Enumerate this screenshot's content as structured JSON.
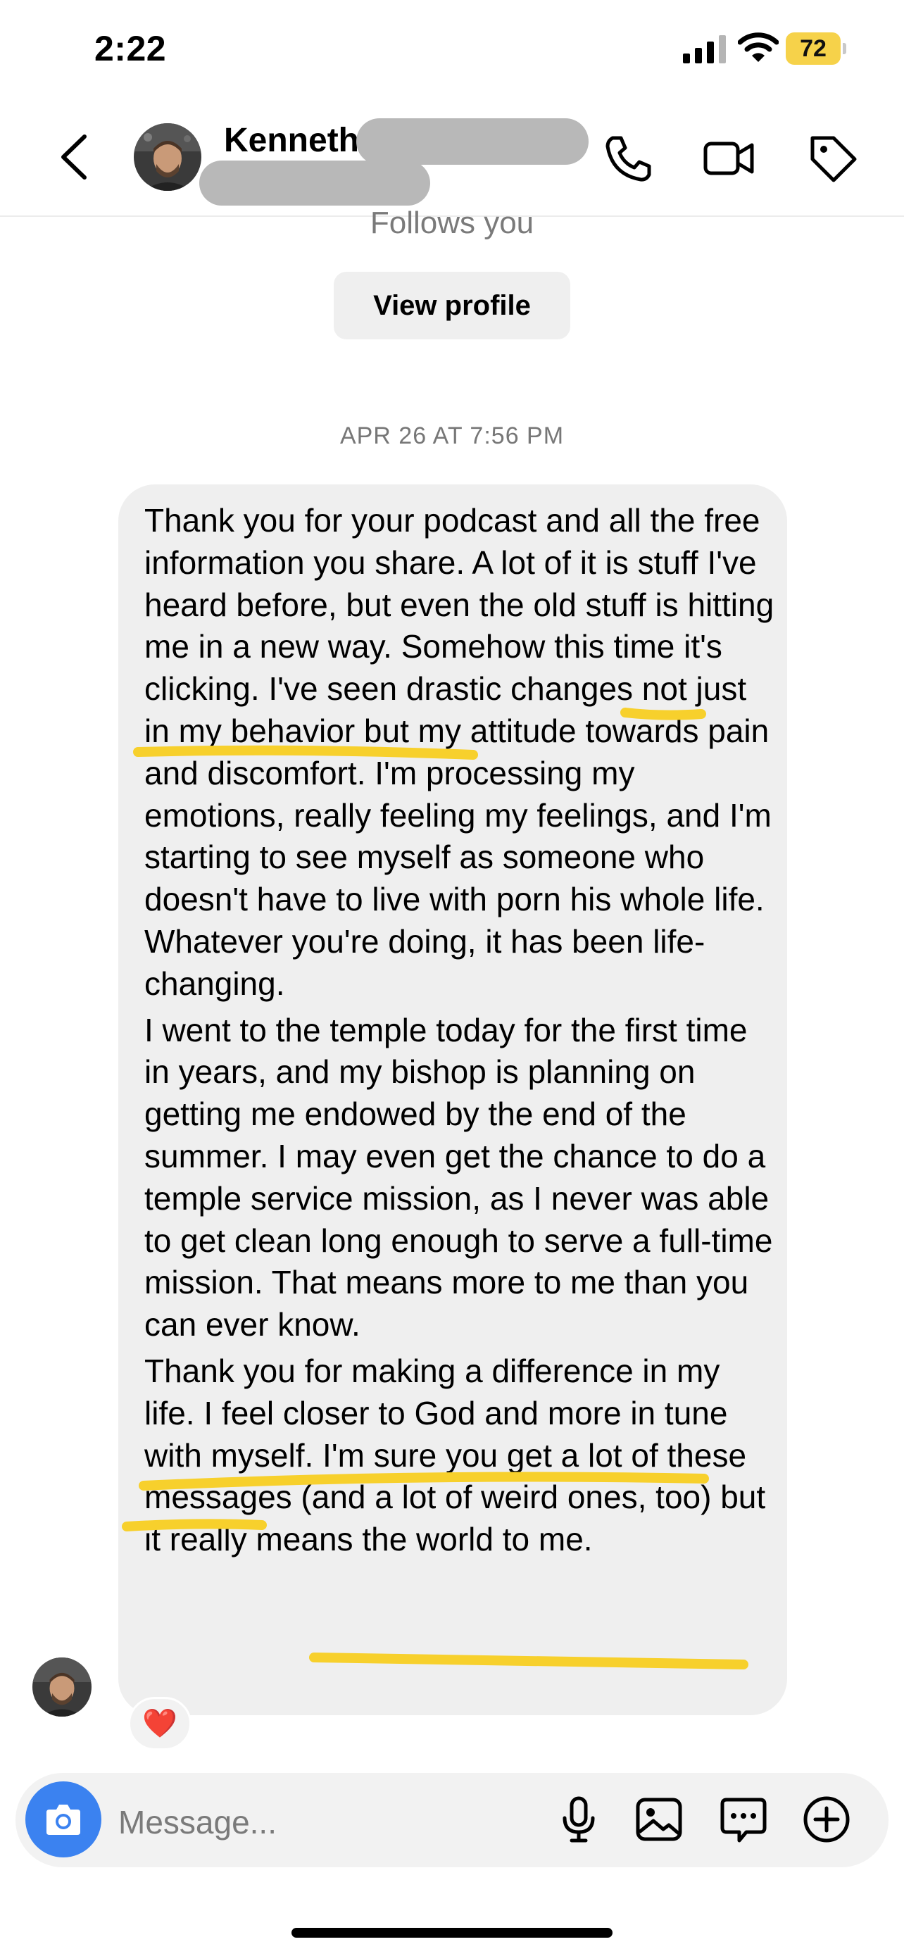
{
  "status_bar": {
    "time": "2:22",
    "battery": "72"
  },
  "header": {
    "name": "Kenneth"
  },
  "profile": {
    "follows_text": "Follows you",
    "view_profile_label": "View profile"
  },
  "thread": {
    "timestamp": "APR 26 AT 7:56 PM",
    "message_paragraphs": [
      "Thank you for your podcast and all the free information you share. A lot of it is stuff I've heard before, but even the old stuff is hitting me in a new way. Somehow this time it's clicking. I've seen drastic changes not just in my behavior but my attitude towards pain and discomfort. I'm processing my emotions, really feeling my feelings, and I'm starting to see myself as someone who doesn't have to live with porn his whole life. Whatever you're doing, it has been life-changing.",
      "I went to the temple today for the first time in years, and my bishop is planning on getting me endowed by the end of the summer. I may even get the chance to do a temple service mission, as I never was able to get clean long enough to serve a full-time mission. That means more to me than you can ever know.",
      "Thank you for making a difference in my life. I feel closer to God and more in tune with myself. I'm sure you get a lot of these messages (and a lot of weird ones, too) but it really means the world to me."
    ],
    "reaction": "❤️",
    "highlight_color": "#f7d02c"
  },
  "composer": {
    "placeholder": "Message..."
  },
  "icons": {
    "header": [
      "back-chevron-icon",
      "phone-icon",
      "video-camera-icon",
      "tag-icon"
    ],
    "composer": [
      "camera-icon",
      "microphone-icon",
      "image-icon",
      "sticker-chat-icon",
      "plus-icon"
    ]
  },
  "colors": {
    "camera_button": "#3b82f0",
    "battery": "#f6d24a",
    "bubble": "#efefef"
  }
}
